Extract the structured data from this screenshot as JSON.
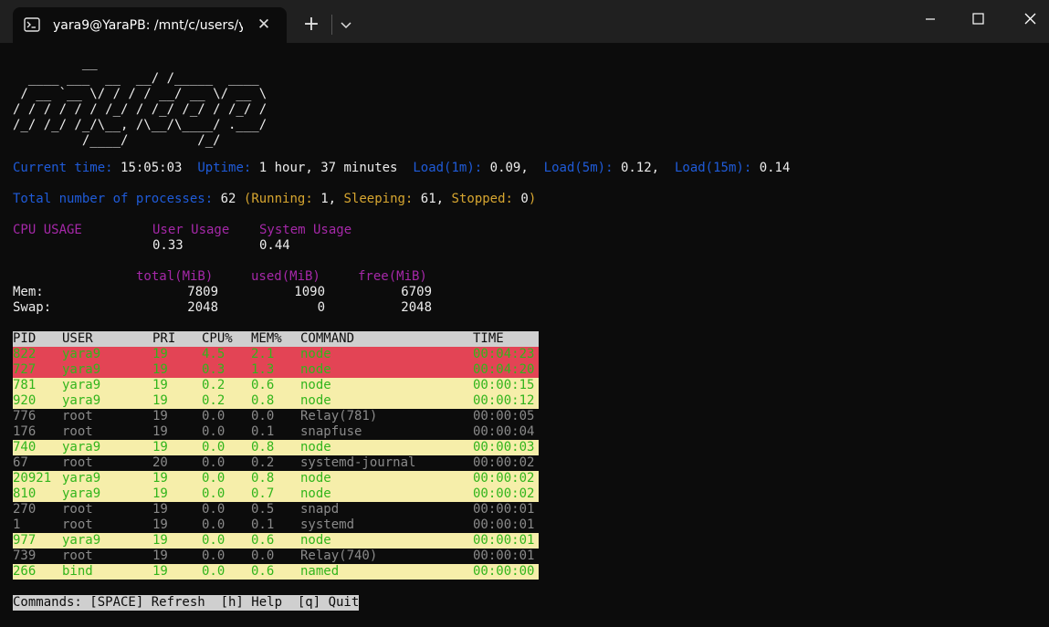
{
  "window": {
    "tab_title": "yara9@YaraPB: /mnt/c/users/yara9",
    "tab_icon": "terminal-icon",
    "new_tab_label": "+",
    "close_tab_label": "✕"
  },
  "banner": [
    "         __",
    "  ____ ___  __  __/ /_____  ____",
    " / __ `__ \\/ / / / __/ __ \\/ __ \\",
    "/ / / / / / /_/ / /_/ /_/ / /_/ /",
    "/_/ /_/ /_/\\__, /\\__/\\____/ .___/",
    "         /____/         /_/"
  ],
  "status": {
    "time_label": "Current time:",
    "time_value": "15:05:03",
    "uptime_label": "Uptime:",
    "uptime_value": "1 hour, 37 minutes",
    "load1_label": "Load(1m):",
    "load1_value": "0.09,",
    "load5_label": "Load(5m):",
    "load5_value": "0.12,",
    "load15_label": "Load(15m):",
    "load15_value": "0.14"
  },
  "processes": {
    "label": "Total number of processes:",
    "total": "62",
    "open": "(",
    "running_label": "Running:",
    "running": "1,",
    "sleeping_label": "Sleeping:",
    "sleeping": "61,",
    "stopped_label": "Stopped:",
    "stopped": "0",
    "close": ")"
  },
  "cpu": {
    "title": "CPU USAGE",
    "user_label": "User Usage",
    "system_label": "System Usage",
    "user_value": "0.33",
    "system_value": "0.44"
  },
  "memory": {
    "total_header": "total(MiB)",
    "used_header": "used(MiB)",
    "free_header": "free(MiB)",
    "rows": [
      {
        "name": "Mem:",
        "total": "7809",
        "used": "1090",
        "free": "6709"
      },
      {
        "name": "Swap:",
        "total": "2048",
        "used": "0",
        "free": "2048"
      }
    ]
  },
  "table": {
    "headers": [
      "PID",
      "USER",
      "PRI",
      "CPU%",
      "MEM%",
      "COMMAND",
      "TIME"
    ],
    "rows": [
      {
        "pid": "822",
        "user": "yara9",
        "pri": "19",
        "cpu": "4.5",
        "mem": "2.1",
        "cmd": "node",
        "time": "00:04:23",
        "style": "hot"
      },
      {
        "pid": "727",
        "user": "yara9",
        "pri": "19",
        "cpu": "0.3",
        "mem": "1.3",
        "cmd": "node",
        "time": "00:04:20",
        "style": "hot"
      },
      {
        "pid": "781",
        "user": "yara9",
        "pri": "19",
        "cpu": "0.2",
        "mem": "0.6",
        "cmd": "node",
        "time": "00:00:15",
        "style": "warm"
      },
      {
        "pid": "920",
        "user": "yara9",
        "pri": "19",
        "cpu": "0.2",
        "mem": "0.8",
        "cmd": "node",
        "time": "00:00:12",
        "style": "warm"
      },
      {
        "pid": "776",
        "user": "root",
        "pri": "19",
        "cpu": "0.0",
        "mem": "0.0",
        "cmd": "Relay(781)",
        "time": "00:00:05",
        "style": "idle"
      },
      {
        "pid": "176",
        "user": "root",
        "pri": "19",
        "cpu": "0.0",
        "mem": "0.1",
        "cmd": "snapfuse",
        "time": "00:00:04",
        "style": "idle"
      },
      {
        "pid": "740",
        "user": "yara9",
        "pri": "19",
        "cpu": "0.0",
        "mem": "0.8",
        "cmd": "node",
        "time": "00:00:03",
        "style": "warm"
      },
      {
        "pid": "67",
        "user": "root",
        "pri": "20",
        "cpu": "0.0",
        "mem": "0.2",
        "cmd": "systemd-journal",
        "time": "00:00:02",
        "style": "idle"
      },
      {
        "pid": "20921",
        "user": "yara9",
        "pri": "19",
        "cpu": "0.0",
        "mem": "0.8",
        "cmd": "node",
        "time": "00:00:02",
        "style": "warm"
      },
      {
        "pid": "810",
        "user": "yara9",
        "pri": "19",
        "cpu": "0.0",
        "mem": "0.7",
        "cmd": "node",
        "time": "00:00:02",
        "style": "warm"
      },
      {
        "pid": "270",
        "user": "root",
        "pri": "19",
        "cpu": "0.0",
        "mem": "0.5",
        "cmd": "snapd",
        "time": "00:00:01",
        "style": "idle"
      },
      {
        "pid": "1",
        "user": "root",
        "pri": "19",
        "cpu": "0.0",
        "mem": "0.1",
        "cmd": "systemd",
        "time": "00:00:01",
        "style": "idle"
      },
      {
        "pid": "977",
        "user": "yara9",
        "pri": "19",
        "cpu": "0.0",
        "mem": "0.6",
        "cmd": "node",
        "time": "00:00:01",
        "style": "warm"
      },
      {
        "pid": "739",
        "user": "root",
        "pri": "19",
        "cpu": "0.0",
        "mem": "0.0",
        "cmd": "Relay(740)",
        "time": "00:00:01",
        "style": "idle"
      },
      {
        "pid": "266",
        "user": "bind",
        "pri": "19",
        "cpu": "0.0",
        "mem": "0.6",
        "cmd": "named",
        "time": "00:00:00",
        "style": "warm"
      }
    ]
  },
  "commands": "Commands: [SPACE] Refresh  [h] Help  [q] Quit",
  "colors": {
    "hot_row": "#e34455",
    "warm_row": "#f6eeaa",
    "row_text": "#32b51c",
    "label_blue": "#1f5bd9",
    "label_purple": "#a528a8",
    "label_yellow": "#d7a630"
  }
}
